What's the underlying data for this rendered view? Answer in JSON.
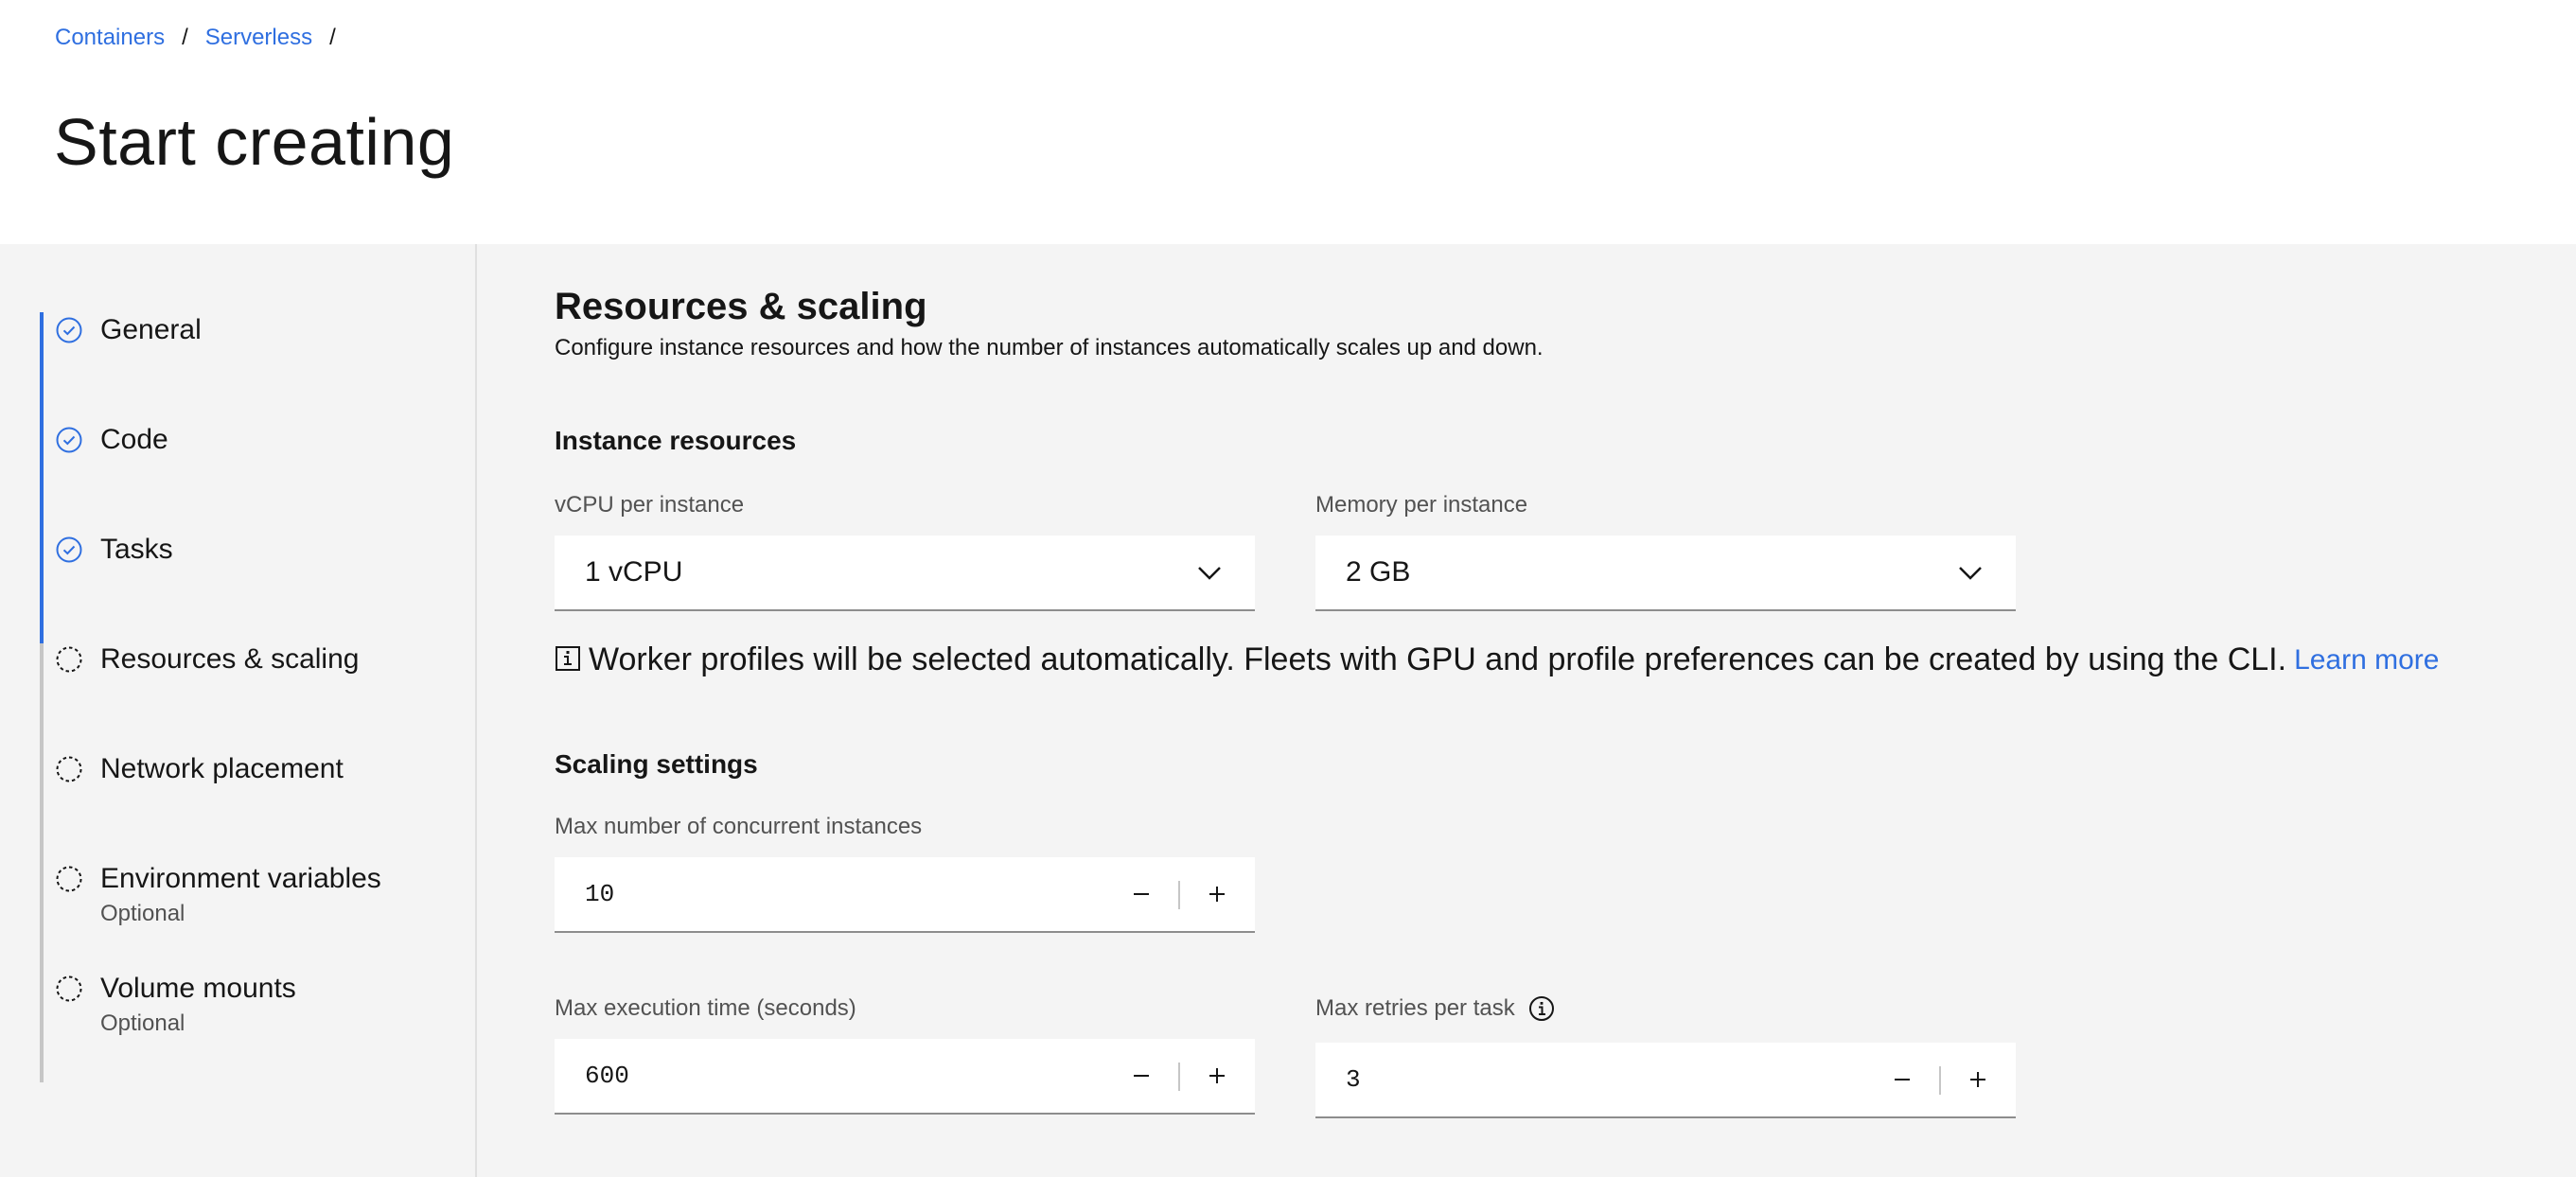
{
  "breadcrumb": {
    "items": [
      "Containers",
      "Serverless"
    ],
    "separator": "/"
  },
  "page_title": "Start creating",
  "steps": [
    {
      "label": "General",
      "sub": "",
      "state": "complete"
    },
    {
      "label": "Code",
      "sub": "",
      "state": "complete"
    },
    {
      "label": "Tasks",
      "sub": "",
      "state": "complete"
    },
    {
      "label": "Resources & scaling",
      "sub": "",
      "state": "incomplete"
    },
    {
      "label": "Network placement",
      "sub": "",
      "state": "incomplete"
    },
    {
      "label": "Environment variables",
      "sub": "Optional",
      "state": "incomplete"
    },
    {
      "label": "Volume mounts",
      "sub": "Optional",
      "state": "incomplete"
    }
  ],
  "section": {
    "title": "Resources & scaling",
    "description": "Configure instance resources and how the number of instances automatically scales up and down."
  },
  "instance_resources": {
    "title": "Instance resources",
    "vcpu": {
      "label": "vCPU per instance",
      "value": "1 vCPU"
    },
    "memory": {
      "label": "Memory per instance",
      "value": "2 GB"
    }
  },
  "notice": {
    "text": "Worker profiles will be selected automatically. Fleets with GPU and profile preferences can be created by using the CLI.",
    "link": "Learn more"
  },
  "scaling": {
    "title": "Scaling settings",
    "max_instances": {
      "label": "Max number of concurrent instances",
      "value": "10"
    },
    "max_exec_time": {
      "label": "Max execution time (seconds)",
      "value": "600"
    },
    "max_retries": {
      "label": "Max retries per task",
      "value": "3"
    }
  },
  "colors": {
    "accent": "#2f6fe0",
    "background": "#f4f4f4",
    "text": "#161616",
    "muted": "#525252"
  },
  "icons": {
    "step_complete": "checkmark-outline-icon",
    "step_incomplete": "circle-dash-icon",
    "dropdown": "chevron-down-icon",
    "notice": "information-square-icon",
    "tooltip": "information-icon",
    "decrement": "subtract-icon",
    "increment": "add-icon"
  }
}
